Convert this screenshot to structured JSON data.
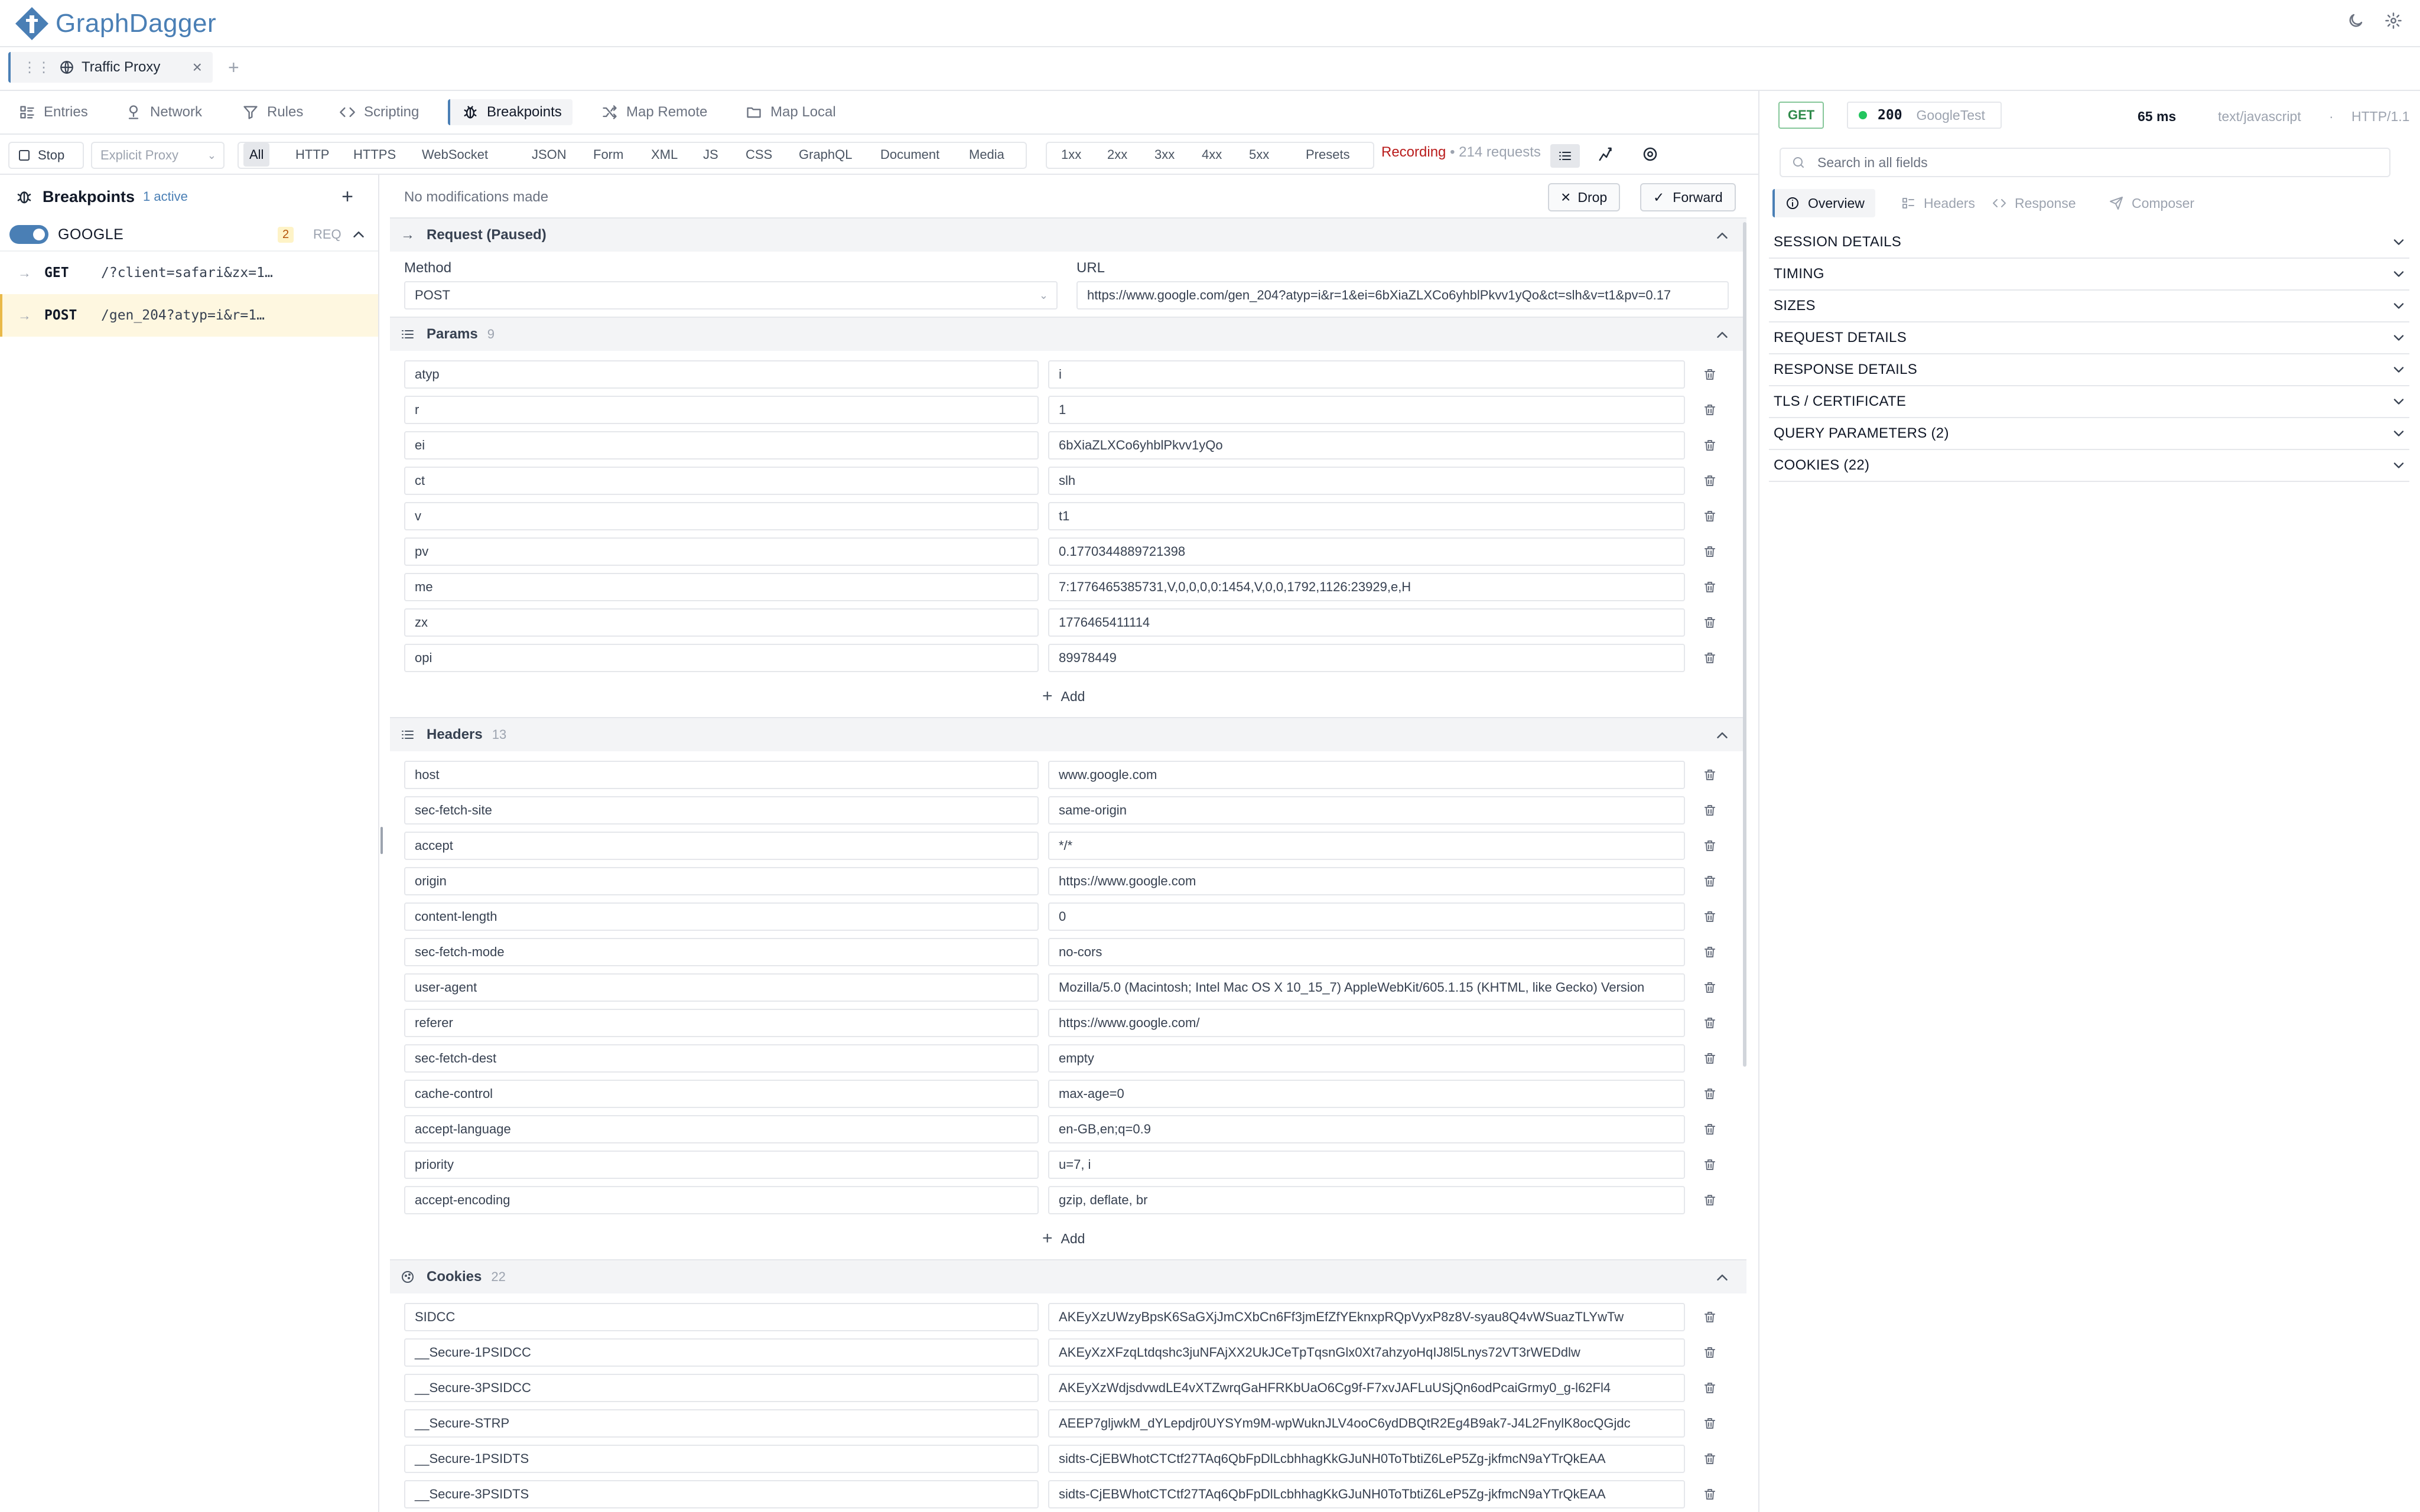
{
  "app": {
    "name": "GraphDagger"
  },
  "session_tab": {
    "label": "Traffic Proxy"
  },
  "nav": {
    "items": [
      {
        "label": "Entries",
        "icon": "list-icon"
      },
      {
        "label": "Network",
        "icon": "network-icon"
      },
      {
        "label": "Rules",
        "icon": "filter-icon"
      },
      {
        "label": "Scripting",
        "icon": "code-icon"
      },
      {
        "label": "Breakpoints",
        "icon": "bug-icon",
        "active": true
      },
      {
        "label": "Map Remote",
        "icon": "shuffle-icon"
      },
      {
        "label": "Map Local",
        "icon": "folder-icon"
      }
    ]
  },
  "toolbar": {
    "stop_label": "Stop",
    "proxy_mode": "Explicit Proxy",
    "type_filters": [
      "All",
      "HTTP",
      "HTTPS",
      "WebSocket",
      "JSON",
      "Form",
      "XML",
      "JS",
      "CSS",
      "GraphQL",
      "Document",
      "Media"
    ],
    "status_filters": [
      "1xx",
      "2xx",
      "3xx",
      "4xx",
      "5xx",
      "Presets"
    ],
    "recording_label": "Recording",
    "requests_count": "• 214 requests"
  },
  "sidebar": {
    "title": "Breakpoints",
    "active_label": "1 active",
    "group": {
      "name": "GOOGLE",
      "count": "2",
      "type": "REQ"
    },
    "rows": [
      {
        "method": "GET",
        "path": "/?client=safari&zx=1…"
      },
      {
        "method": "POST",
        "path": "/gen_204?atyp=i&r=1…"
      }
    ]
  },
  "editor": {
    "status": "No modifications made",
    "drop_label": "Drop",
    "forward_label": "Forward",
    "request_title": "Request (Paused)",
    "method_label": "Method",
    "method_value": "POST",
    "url_label": "URL",
    "url_value": "https://www.google.com/gen_204?atyp=i&r=1&ei=6bXiaZLXCo6yhblPkvv1yQo&ct=slh&v=t1&pv=0.17",
    "params_title": "Params",
    "params_count": "9",
    "params": [
      {
        "k": "atyp",
        "v": "i"
      },
      {
        "k": "r",
        "v": "1"
      },
      {
        "k": "ei",
        "v": "6bXiaZLXCo6yhblPkvv1yQo"
      },
      {
        "k": "ct",
        "v": "slh"
      },
      {
        "k": "v",
        "v": "t1"
      },
      {
        "k": "pv",
        "v": "0.1770344889721398"
      },
      {
        "k": "me",
        "v": "7:1776465385731,V,0,0,0,0:1454,V,0,0,1792,1126:23929,e,H"
      },
      {
        "k": "zx",
        "v": "1776465411114"
      },
      {
        "k": "opi",
        "v": "89978449"
      }
    ],
    "add_label": "Add",
    "headers_title": "Headers",
    "headers_count": "13",
    "headers": [
      {
        "k": "host",
        "v": "www.google.com"
      },
      {
        "k": "sec-fetch-site",
        "v": "same-origin"
      },
      {
        "k": "accept",
        "v": "*/*"
      },
      {
        "k": "origin",
        "v": "https://www.google.com"
      },
      {
        "k": "content-length",
        "v": "0"
      },
      {
        "k": "sec-fetch-mode",
        "v": "no-cors"
      },
      {
        "k": "user-agent",
        "v": "Mozilla/5.0 (Macintosh; Intel Mac OS X 10_15_7) AppleWebKit/605.1.15 (KHTML, like Gecko) Version"
      },
      {
        "k": "referer",
        "v": "https://www.google.com/"
      },
      {
        "k": "sec-fetch-dest",
        "v": "empty"
      },
      {
        "k": "cache-control",
        "v": "max-age=0"
      },
      {
        "k": "accept-language",
        "v": "en-GB,en;q=0.9"
      },
      {
        "k": "priority",
        "v": "u=7, i"
      },
      {
        "k": "accept-encoding",
        "v": "gzip, deflate, br"
      }
    ],
    "cookies_title": "Cookies",
    "cookies_count": "22",
    "cookies": [
      {
        "k": "SIDCC",
        "v": "AKEyXzUWzyBpsK6SaGXjJmCXbCn6Ff3jmEfZfYEknxpRQpVyxP8z8V-syau8Q4vWSuazTLYwTw"
      },
      {
        "k": "__Secure-1PSIDCC",
        "v": "AKEyXzXFzqLtdqshc3juNFAjXX2UkJCeTpTqsnGlx0Xt7ahzyoHqIJ8l5Lnys72VT3rWEDdlw"
      },
      {
        "k": "__Secure-3PSIDCC",
        "v": "AKEyXzWdjsdvwdLE4vXTZwrqGaHFRKbUaO6Cg9f-F7xvJAFLuUSjQn6odPcaiGrmy0_g-l62Fl4"
      },
      {
        "k": "__Secure-STRP",
        "v": "AEEP7gljwkM_dYLepdjr0UYSYm9M-wpWuknJLV4ooC6ydDBQtR2Eg4B9ak7-J4L2FnylK8ocQGjdc"
      },
      {
        "k": "__Secure-1PSIDTS",
        "v": "sidts-CjEBWhotCTCtf27TAq6QbFpDlLcbhhagKkGJuNH0ToTbtiZ6LeP5Zg-jkfmcN9aYTrQkEAA"
      },
      {
        "k": "__Secure-3PSIDTS",
        "v": "sidts-CjEBWhotCTCtf27TAq6QbFpDlLcbhhagKkGJuNH0ToTbtiZ6LeP5Zg-jkfmcN9aYTrQkEAA"
      }
    ]
  },
  "inspector": {
    "method": "GET",
    "status_code": "200",
    "host_name": "GoogleTest",
    "duration": "65 ms",
    "content_type": "text/javascript",
    "protocol": "HTTP/1.1",
    "search_placeholder": "Search in all fields",
    "tabs": [
      "Overview",
      "Headers",
      "Response",
      "Composer"
    ],
    "sections": [
      "SESSION DETAILS",
      "TIMING",
      "SIZES",
      "REQUEST DETAILS",
      "RESPONSE DETAILS",
      "TLS / CERTIFICATE",
      "QUERY PARAMETERS (2)",
      "COOKIES (22)"
    ]
  }
}
